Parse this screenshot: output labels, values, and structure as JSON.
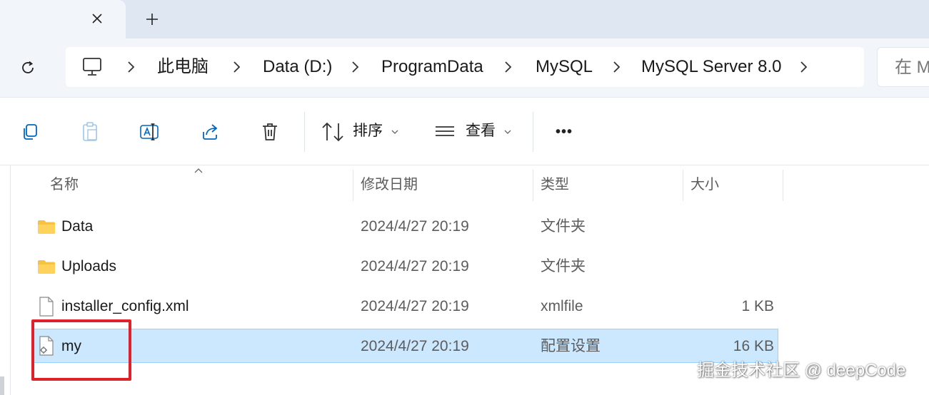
{
  "tabs": {
    "close_glyph": "✕",
    "new_glyph": "+"
  },
  "address": {
    "crumbs": [
      "此电脑",
      "Data (D:)",
      "ProgramData",
      "MySQL",
      "MySQL Server 8.0"
    ],
    "search_placeholder": "在 M"
  },
  "toolbar": {
    "sort_label": "排序",
    "view_label": "查看",
    "more_glyph": "•••"
  },
  "columns": {
    "name": "名称",
    "modified": "修改日期",
    "type": "类型",
    "size": "大小"
  },
  "files": [
    {
      "name": "Data",
      "modified": "2024/4/27 20:19",
      "type": "文件夹",
      "size": "",
      "icon": "folder-icon"
    },
    {
      "name": "Uploads",
      "modified": "2024/4/27 20:19",
      "type": "文件夹",
      "size": "",
      "icon": "folder-icon"
    },
    {
      "name": "installer_config.xml",
      "modified": "2024/4/27 20:19",
      "type": "xmlfile",
      "size": "1 KB",
      "icon": "file-icon"
    },
    {
      "name": "my",
      "modified": "2024/4/27 20:19",
      "type": "配置设置",
      "size": "16 KB",
      "icon": "config-file-icon",
      "selected": true
    }
  ],
  "watermark": "掘金技术社区 @ deepCode",
  "colors": {
    "accent": "#0067c0",
    "selection": "#cce8ff",
    "highlight_box": "#e0202a",
    "folder": "#f5c242"
  }
}
